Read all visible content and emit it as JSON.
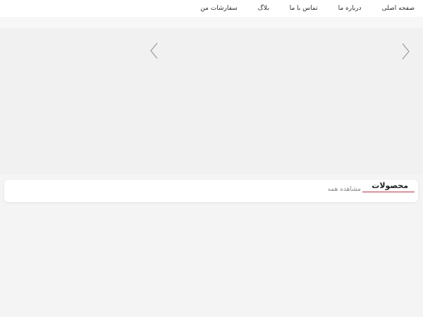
{
  "nav": {
    "items": [
      {
        "label": "صفحه اصلی"
      },
      {
        "label": "درباره ما"
      },
      {
        "label": "تماس با ما"
      },
      {
        "label": "بلاگ"
      },
      {
        "label": "سفارشات من"
      }
    ]
  },
  "slider": {
    "prev_icon": "chevron-left-icon",
    "next_icon": "chevron-right-icon"
  },
  "products": {
    "title": "محصولات",
    "view_all": "مشاهده همه"
  },
  "colors": {
    "accent": "#b4344a",
    "background": "#f4f4f4"
  }
}
